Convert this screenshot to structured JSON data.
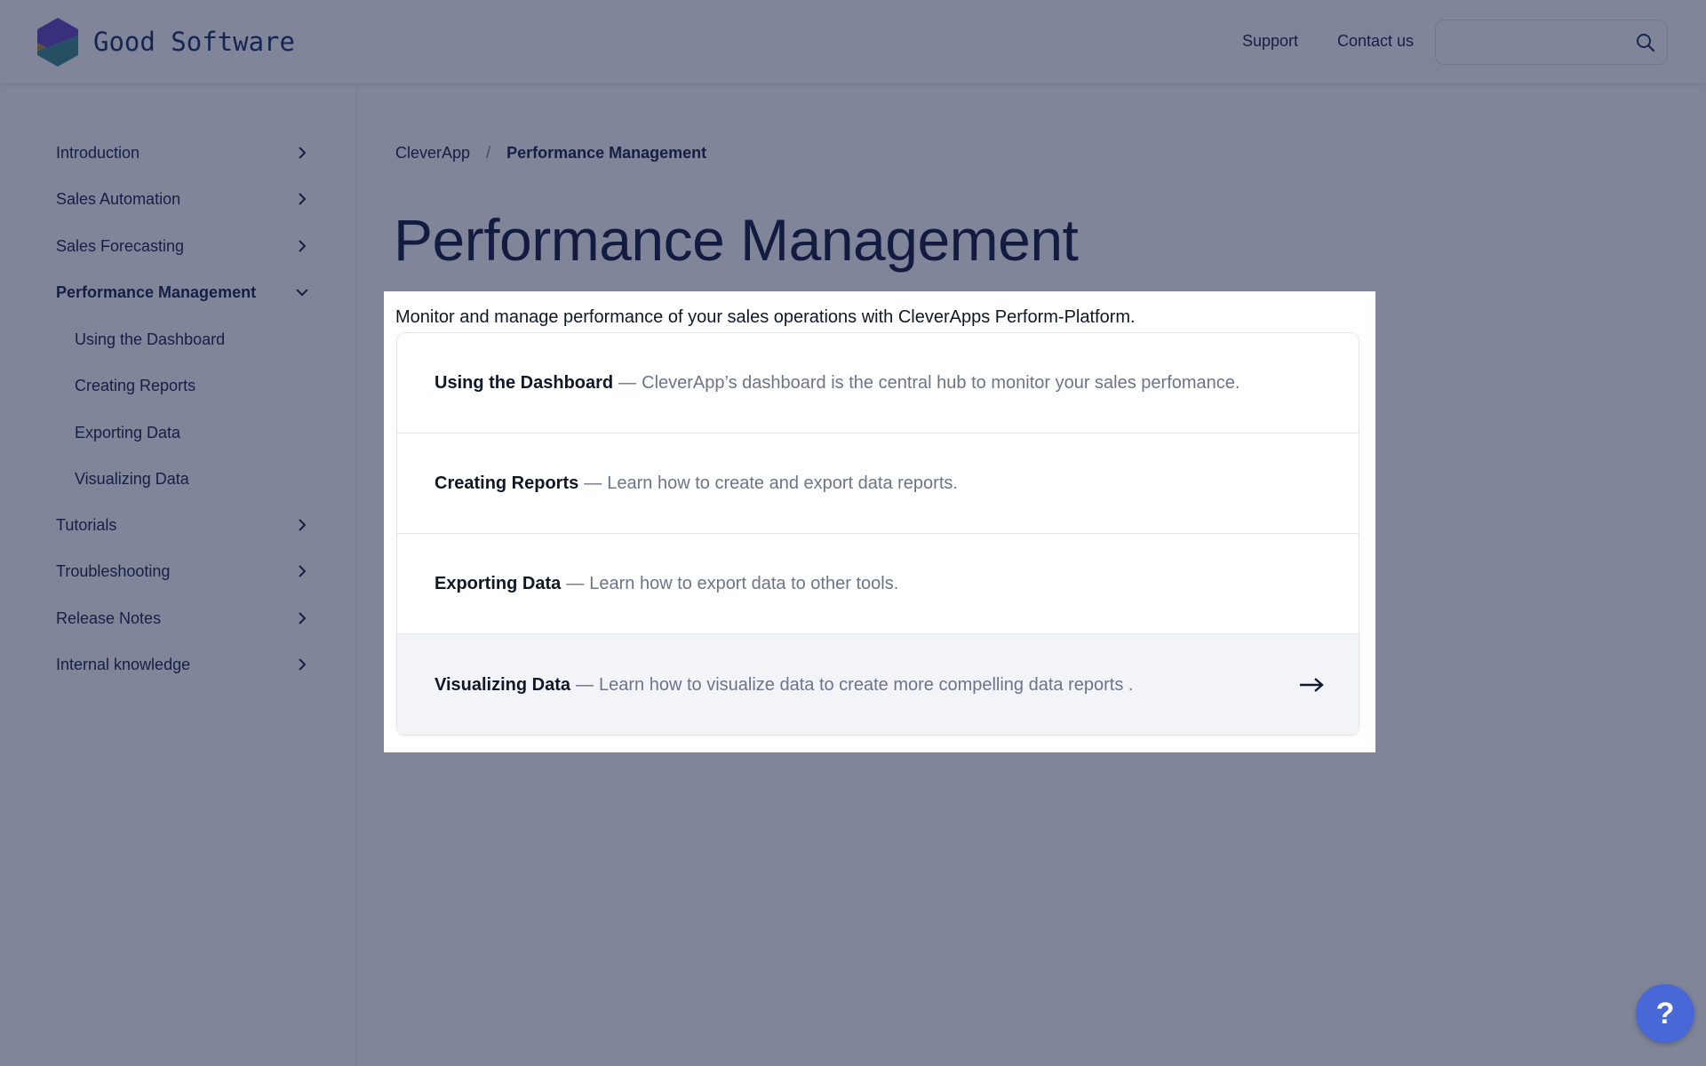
{
  "header": {
    "brand": "Good Software",
    "nav": [
      {
        "label": "Support"
      },
      {
        "label": "Contact us"
      }
    ],
    "search": {
      "value": "",
      "placeholder": "",
      "icon": "search-icon"
    }
  },
  "sidebar": {
    "items": [
      {
        "label": "Introduction",
        "icon": "chevron-right-icon"
      },
      {
        "label": "Sales Automation",
        "icon": "chevron-right-icon"
      },
      {
        "label": "Sales Forecasting",
        "icon": "chevron-right-icon"
      },
      {
        "label": "Performance Management",
        "icon": "chevron-down-icon",
        "active": true,
        "children": [
          {
            "label": "Using the Dashboard"
          },
          {
            "label": "Creating Reports"
          },
          {
            "label": "Exporting Data"
          },
          {
            "label": "Visualizing Data"
          }
        ]
      },
      {
        "label": "Tutorials",
        "icon": "chevron-right-icon"
      },
      {
        "label": "Troubleshooting",
        "icon": "chevron-right-icon"
      },
      {
        "label": "Release Notes",
        "icon": "chevron-right-icon"
      },
      {
        "label": "Internal knowledge",
        "icon": "chevron-right-icon"
      }
    ]
  },
  "main": {
    "breadcrumb": {
      "root": "CleverApp",
      "separator": "/",
      "current": "Performance Management"
    },
    "title": "Performance Management",
    "intro": "Monitor and manage performance of your sales operations with CleverApps Perform-Platform.",
    "cards": [
      {
        "title": "Using the Dashboard",
        "dash": "—",
        "description": "CleverApp’s dashboard is the central hub to monitor your sales perfomance."
      },
      {
        "title": "Creating Reports",
        "dash": "—",
        "description": "Learn how to create and export data reports."
      },
      {
        "title": "Exporting Data",
        "dash": "—",
        "description": "Learn how to export data to other tools."
      },
      {
        "title": "Visualizing Data",
        "dash": "—",
        "description": "Learn how to visualize data to create more compelling data reports .",
        "hovered": true,
        "icon": "arrow-right-icon"
      }
    ]
  },
  "help_button": {
    "label": "?",
    "icon": "question-icon"
  },
  "colors": {
    "brand_text": "#1f3668",
    "text_dark": "#1e2a4f",
    "muted": "#6b7489",
    "help_button": "#4768d6",
    "overlay": "rgba(13,22,60,0.52)",
    "logo_purple": "#6a4fc4",
    "logo_teal": "#3f8f8c",
    "logo_gold": "#b59a44"
  }
}
